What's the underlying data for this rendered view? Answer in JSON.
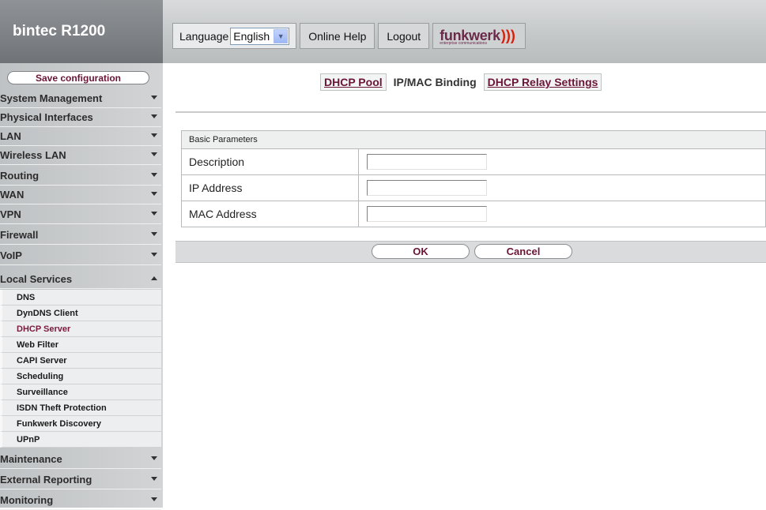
{
  "brand": {
    "title": "bintec R1200"
  },
  "header": {
    "language_label": "Language",
    "language_value": "English",
    "online_help": "Online Help",
    "logout": "Logout",
    "logo_text": "funkwerk",
    "logo_subtext": "enterprise communications"
  },
  "sidebar": {
    "save_label": "Save configuration",
    "menu": [
      {
        "label": "System Management"
      },
      {
        "label": "Physical Interfaces"
      },
      {
        "label": "LAN"
      },
      {
        "label": "Wireless LAN"
      },
      {
        "label": "Routing"
      },
      {
        "label": "WAN"
      },
      {
        "label": "VPN"
      },
      {
        "label": "Firewall"
      },
      {
        "label": "VoIP"
      },
      {
        "label": "Local Services"
      },
      {
        "label": "Maintenance"
      },
      {
        "label": "External Reporting"
      },
      {
        "label": "Monitoring"
      }
    ],
    "sub_items": [
      {
        "label": "DNS"
      },
      {
        "label": "DynDNS Client"
      },
      {
        "label": "DHCP Server"
      },
      {
        "label": "Web Filter"
      },
      {
        "label": "CAPI Server"
      },
      {
        "label": "Scheduling"
      },
      {
        "label": "Surveillance"
      },
      {
        "label": "ISDN Theft Protection"
      },
      {
        "label": "Funkwerk Discovery"
      },
      {
        "label": "UPnP"
      }
    ],
    "active_sub": "DHCP Server"
  },
  "tabs": [
    {
      "label": "DHCP Pool"
    },
    {
      "label": "IP/MAC Binding"
    },
    {
      "label": "DHCP Relay Settings"
    }
  ],
  "form": {
    "section_title": "Basic Parameters",
    "fields": [
      {
        "label": "Description",
        "value": ""
      },
      {
        "label": "IP Address",
        "value": ""
      },
      {
        "label": "MAC Address",
        "value": ""
      }
    ],
    "ok_label": "OK",
    "cancel_label": "Cancel"
  },
  "colors": {
    "accent": "#6a1434",
    "logo_red": "#d6200a"
  }
}
